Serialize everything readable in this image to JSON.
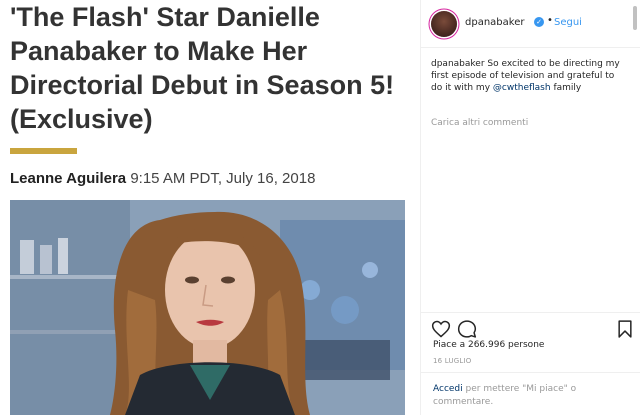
{
  "article": {
    "headline_lines": [
      "'The Flash' Star Danielle",
      "Panabaker to Make Her",
      "Directorial Debut in Season 5!",
      "(Exclusive)"
    ],
    "author": "Leanne Aguilera",
    "datetime": "9:15 AM PDT, July 16, 2018",
    "accent_color": "#c9a53e"
  },
  "instagram": {
    "username": "dpanabaker",
    "follow_label": "Segui",
    "separator": "•",
    "caption_user": "dpanabaker",
    "caption_text": "So excited to be directing my first episode of television and grateful to do it with my",
    "caption_mention": "@cwtheflash",
    "caption_after": "family",
    "load_more": "Carica altri commenti",
    "likes": "Piace a 266.996 persone",
    "date": "16 LUGLIO",
    "login_link": "Accedi",
    "login_rest": "per mettere \"Mi piace\" o commentare.",
    "link_color": "#003569",
    "follow_color": "#3897f0"
  },
  "icons": {
    "like": "heart-icon",
    "comment": "comment-icon",
    "save": "bookmark-icon",
    "verified": "verified-badge-icon"
  }
}
